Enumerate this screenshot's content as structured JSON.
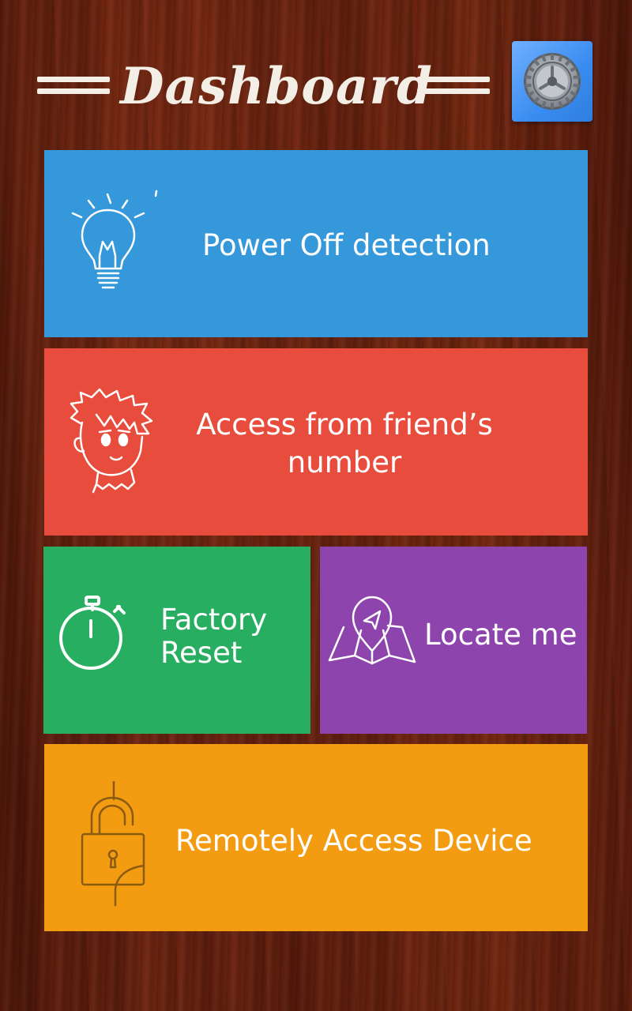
{
  "header": {
    "title": "Dashboard",
    "settings_icon": "settings-gear-icon"
  },
  "tiles": {
    "power_off": {
      "label": "Power Off detection",
      "icon": "lightbulb-icon",
      "color": "#3598db"
    },
    "friend_access": {
      "label": "Access from friend’s\nnumber",
      "icon": "person-face-icon",
      "color": "#e74c3c"
    },
    "factory_reset": {
      "label": "Factory\nReset",
      "icon": "stopwatch-icon",
      "color": "#27ae60"
    },
    "locate_me": {
      "label": "Locate me",
      "icon": "map-pin-icon",
      "color": "#8e44ad"
    },
    "remote_access": {
      "label": "Remotely Access Device",
      "icon": "padlock-icon",
      "color": "#f39c12"
    }
  },
  "colors": {
    "background": "#5a1e0e",
    "title": "#f4efe6",
    "settings_button": "#4a98f5"
  }
}
